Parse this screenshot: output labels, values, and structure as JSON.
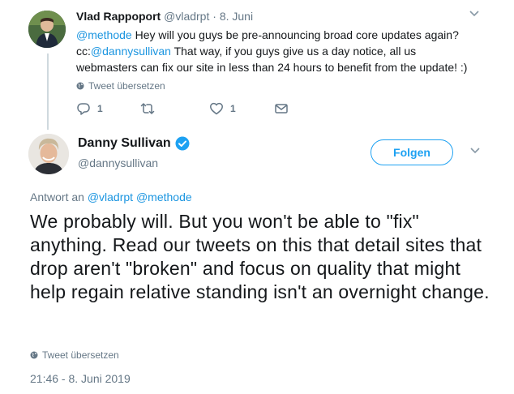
{
  "tweet1": {
    "name": "Vlad Rappoport",
    "handle": "@vladrpt",
    "separator": "·",
    "time": "8. Juni",
    "text_mention": "@methode",
    "text_line1": " Hey will you guys be pre-announcing broad core updates again?",
    "text_cc": "cc:",
    "text_cc_mention": "@dannysullivan",
    "text_rest": " That way, if you guys give us a day notice, all us webmasters can fix our site in less than 24 hours to benefit from the update! :)",
    "translate_label": "Tweet übersetzen",
    "reply_count": "1",
    "like_count": "1"
  },
  "tweet2": {
    "name": "Danny Sullivan",
    "handle": "@dannysullivan",
    "follow_label": "Folgen",
    "reply_prefix": "Antwort an",
    "reply_to_1": "@vladrpt",
    "reply_to_2": "@methode",
    "text": "We probably will. But you won't be able to \"fix\" anything. Read our tweets on this that detail sites that drop aren't \"broken\" and focus on quality that might help regain relative standing isn't an overnight change.",
    "translate_label": "Tweet übersetzen",
    "timestamp": "21:46 - 8. Juni 2019"
  },
  "colors": {
    "accent": "#1da1f2",
    "link": "#1b95e0",
    "muted": "#657786",
    "text": "#14171a"
  },
  "icons": [
    "chevron-down-icon",
    "globe-icon",
    "reply-icon",
    "retweet-icon",
    "heart-icon",
    "envelope-icon",
    "verified-badge-icon"
  ]
}
